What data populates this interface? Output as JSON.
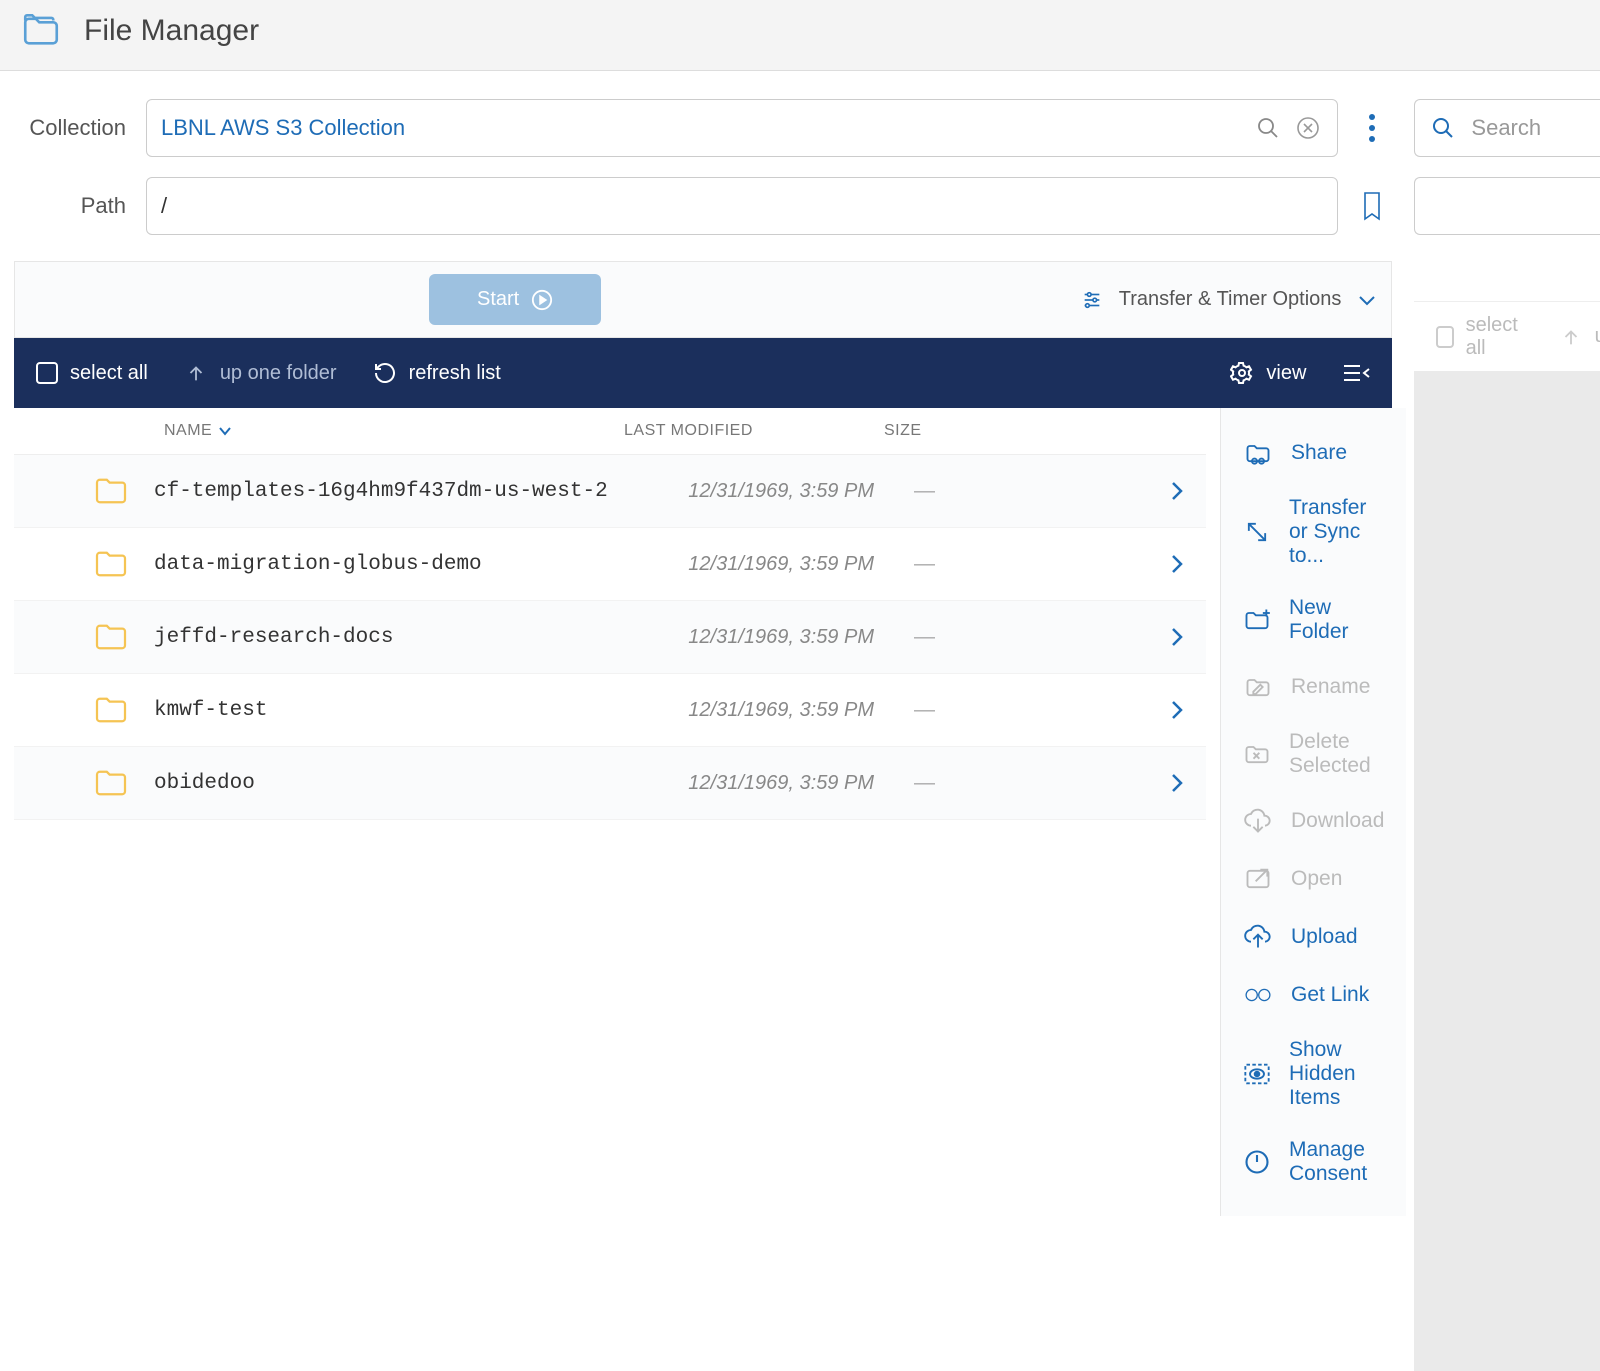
{
  "header": {
    "title": "File Manager"
  },
  "form": {
    "collection_label": "Collection",
    "collection_value": "LBNL AWS S3 Collection",
    "path_label": "Path",
    "path_value": "/",
    "search_placeholder": "Search"
  },
  "actions_bar": {
    "start_label": "Start",
    "options_label": "Transfer & Timer Options"
  },
  "toolbar": {
    "select_all": "select all",
    "up_one": "up one folder",
    "refresh": "refresh list",
    "view": "view"
  },
  "columns": {
    "name": "NAME",
    "modified": "LAST MODIFIED",
    "size": "SIZE"
  },
  "files": [
    {
      "name": "cf-templates-16g4hm9f437dm-us-west-2",
      "modified": "12/31/1969, 3:59 PM",
      "size": "—"
    },
    {
      "name": "data-migration-globus-demo",
      "modified": "12/31/1969, 3:59 PM",
      "size": "—"
    },
    {
      "name": "jeffd-research-docs",
      "modified": "12/31/1969, 3:59 PM",
      "size": "—"
    },
    {
      "name": "kmwf-test",
      "modified": "12/31/1969, 3:59 PM",
      "size": "—"
    },
    {
      "name": "obidedoo",
      "modified": "12/31/1969, 3:59 PM",
      "size": "—"
    }
  ],
  "side_menu": [
    {
      "label": "Share",
      "enabled": true,
      "icon": "share"
    },
    {
      "label": "Transfer or Sync to...",
      "enabled": true,
      "icon": "sync"
    },
    {
      "label": "New Folder",
      "enabled": true,
      "icon": "newfolder"
    },
    {
      "label": "Rename",
      "enabled": false,
      "icon": "rename"
    },
    {
      "label": "Delete Selected",
      "enabled": false,
      "icon": "delete"
    },
    {
      "label": "Download",
      "enabled": false,
      "icon": "download"
    },
    {
      "label": "Open",
      "enabled": false,
      "icon": "open"
    },
    {
      "label": "Upload",
      "enabled": true,
      "icon": "upload"
    },
    {
      "label": "Get Link",
      "enabled": true,
      "icon": "link"
    },
    {
      "label": "Show Hidden Items",
      "enabled": true,
      "icon": "eye"
    },
    {
      "label": "Manage Consent",
      "enabled": true,
      "icon": "power"
    }
  ]
}
